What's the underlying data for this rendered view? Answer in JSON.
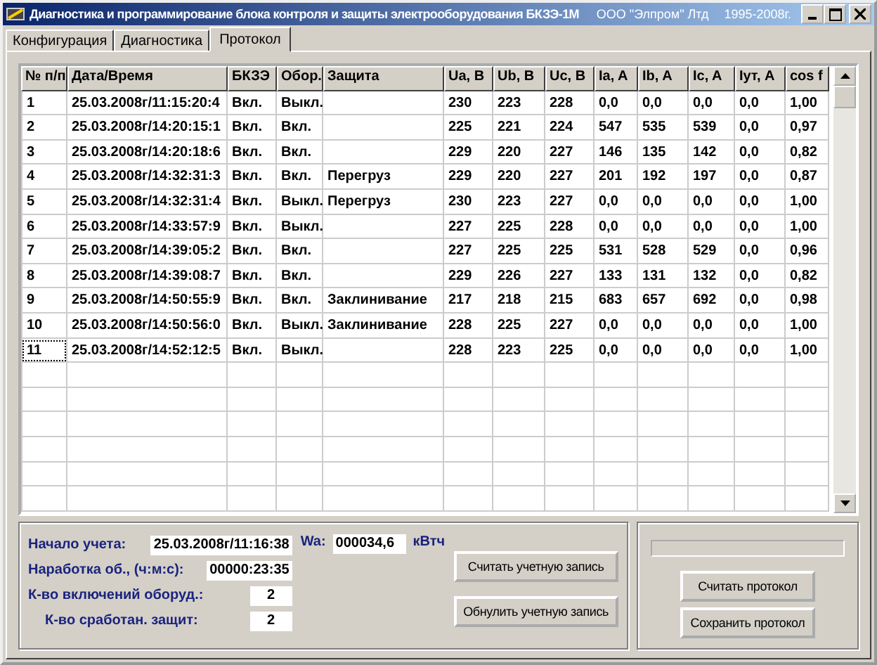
{
  "window": {
    "title": "Диагностика и программирование блока контроля и защиты электрооборудования БКЗЭ-1М",
    "company": "ООО \"Элпром\" Лтд",
    "years": "1995-2008г."
  },
  "tabs": [
    {
      "label": "Конфигурация",
      "selected": false
    },
    {
      "label": "Диагностика",
      "selected": false
    },
    {
      "label": "Протокол",
      "selected": true
    }
  ],
  "table": {
    "columns": [
      "№ п/п",
      "Дата/Время",
      "БКЗЭ",
      "Обор.",
      "Защита",
      "Ua, B",
      "Ub, B",
      "Uc, B",
      "Ia, A",
      "Ib, A",
      "Ic, A",
      "Iyт, A",
      "cos f"
    ],
    "rows": [
      {
        "focused": false,
        "cells": [
          "1",
          "25.03.2008г/11:15:20:4",
          "Вкл.",
          "Выкл.",
          "",
          "230",
          "223",
          "228",
          "0,0",
          "0,0",
          "0,0",
          "0,0",
          "1,00"
        ]
      },
      {
        "focused": false,
        "cells": [
          "2",
          "25.03.2008г/14:20:15:1",
          "Вкл.",
          "Вкл.",
          "",
          "225",
          "221",
          "224",
          "547",
          "535",
          "539",
          "0,0",
          "0,97"
        ]
      },
      {
        "focused": false,
        "cells": [
          "3",
          "25.03.2008г/14:20:18:6",
          "Вкл.",
          "Вкл.",
          "",
          "229",
          "220",
          "227",
          "146",
          "135",
          "142",
          "0,0",
          "0,82"
        ]
      },
      {
        "focused": false,
        "cells": [
          "4",
          "25.03.2008г/14:32:31:3",
          "Вкл.",
          "Вкл.",
          "Перегруз",
          "229",
          "220",
          "227",
          "201",
          "192",
          "197",
          "0,0",
          "0,87"
        ]
      },
      {
        "focused": false,
        "cells": [
          "5",
          "25.03.2008г/14:32:31:4",
          "Вкл.",
          "Выкл.",
          "Перегруз",
          "230",
          "223",
          "227",
          "0,0",
          "0,0",
          "0,0",
          "0,0",
          "1,00"
        ]
      },
      {
        "focused": false,
        "cells": [
          "6",
          "25.03.2008г/14:33:57:9",
          "Вкл.",
          "Выкл.",
          "",
          "227",
          "225",
          "228",
          "0,0",
          "0,0",
          "0,0",
          "0,0",
          "1,00"
        ]
      },
      {
        "focused": false,
        "cells": [
          "7",
          "25.03.2008г/14:39:05:2",
          "Вкл.",
          "Вкл.",
          "",
          "227",
          "225",
          "225",
          "531",
          "528",
          "529",
          "0,0",
          "0,96"
        ]
      },
      {
        "focused": false,
        "cells": [
          "8",
          "25.03.2008г/14:39:08:7",
          "Вкл.",
          "Вкл.",
          "",
          "229",
          "226",
          "227",
          "133",
          "131",
          "132",
          "0,0",
          "0,82"
        ]
      },
      {
        "focused": false,
        "cells": [
          "9",
          "25.03.2008г/14:50:55:9",
          "Вкл.",
          "Вкл.",
          "Заклинивание",
          "217",
          "218",
          "215",
          "683",
          "657",
          "692",
          "0,0",
          "0,98"
        ]
      },
      {
        "focused": false,
        "cells": [
          "10",
          "25.03.2008г/14:50:56:0",
          "Вкл.",
          "Выкл.",
          "Заклинивание",
          "228",
          "225",
          "227",
          "0,0",
          "0,0",
          "0,0",
          "0,0",
          "1,00"
        ]
      },
      {
        "focused": true,
        "cells": [
          "11",
          "25.03.2008г/14:52:12:5",
          "Вкл.",
          "Выкл.",
          "",
          "228",
          "223",
          "225",
          "0,0",
          "0,0",
          "0,0",
          "0,0",
          "1,00"
        ]
      }
    ]
  },
  "account": {
    "fields": [
      {
        "label": "Начало учета:",
        "value": "25.03.2008г/11:16:38"
      },
      {
        "label": "Наработка об., (ч:м:с):",
        "value": "00000:23:35"
      },
      {
        "label": "К-во включений оборуд.:",
        "value": "2"
      },
      {
        "label": "К-во сработан. защит:",
        "value": "2"
      }
    ],
    "energy": {
      "label": "Wa:",
      "value": "000034,6",
      "unit": "кВтч"
    },
    "buttons": [
      "Считать учетную запись",
      "Обнулить учетную запись"
    ]
  },
  "protocol": {
    "progress": {
      "level": 0
    },
    "buttons": [
      "Считать протокол",
      "Сохранить протокол"
    ]
  }
}
